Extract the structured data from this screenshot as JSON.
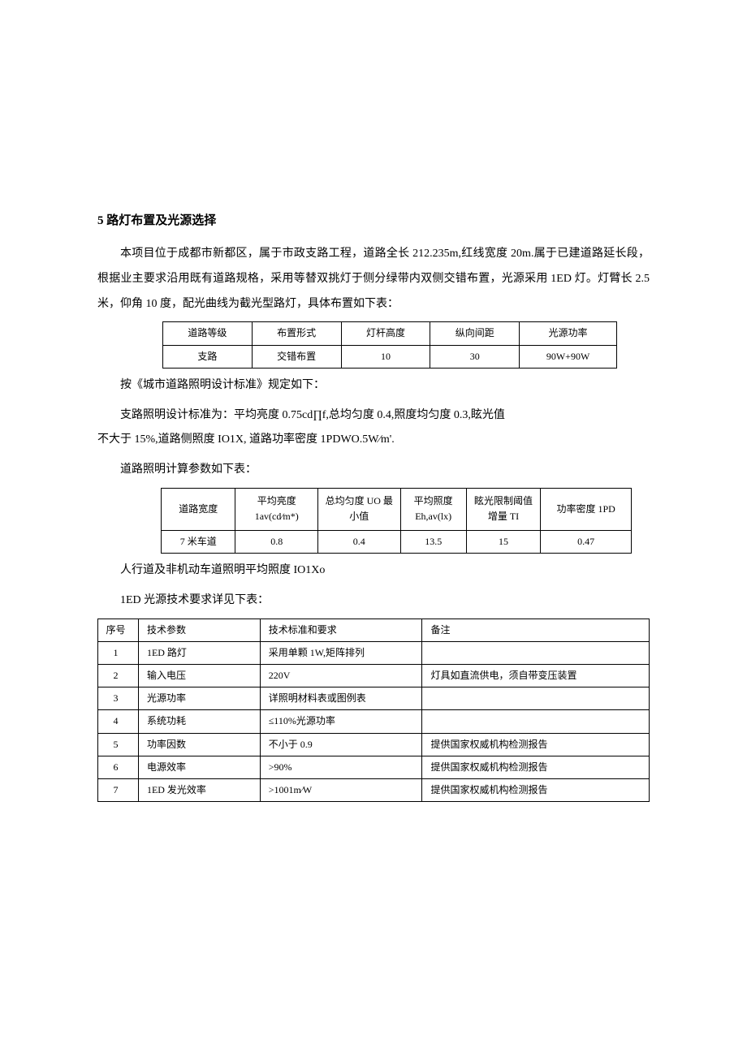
{
  "heading": "5 路灯布置及光源选择",
  "p1": "本项目位于成都市新都区，属于市政支路工程，道路全长 212.235m,红线宽度 20m.属于已建道路延长段，根据业主要求沿用既有道路规格，采用等替双挑灯于侧分绿带内双侧交错布置，光源采用 1ED 灯。灯臂长 2.5 米，仰角 10 度，配光曲线为截光型路灯，具体布置如下表：",
  "table1": {
    "h": [
      "道路等级",
      "布置形式",
      "灯杆高度",
      "纵向间距",
      "光源功率"
    ],
    "r": [
      "支路",
      "交错布置",
      "10",
      "30",
      "90W+90W"
    ]
  },
  "p2": "按《城市道路照明设计标准》规定如下：",
  "p3a": "支路照明设计标准为：平均亮度 0.75cd∏f,总均匀度 0.4,照度均匀度 0.3,眩光值",
  "p3b": "不大于 15%,道路侧照度 IO1X, 道路功率密度 1PDWO.5W⁄m'.",
  "p4": "道路照明计算参数如下表：",
  "table2": {
    "h": [
      "道路宽度",
      "平均亮度\n1av(cd⁄m*)",
      "总均匀度 UO 最小值",
      "平均照度\nEh,av(lx)",
      "眩光限制阈值增量\nTI",
      "功率密度 1PD"
    ],
    "r": [
      "7 米车道",
      "0.8",
      "0.4",
      "13.5",
      "15",
      "0.47"
    ]
  },
  "p5": "人行道及非机动车道照明平均照度 IO1Xo",
  "p6": "1ED 光源技术要求详见下表：",
  "table3": {
    "h": [
      "序号",
      "技术参数",
      "技术标准和要求",
      "备注"
    ],
    "rows": [
      [
        "1",
        "1ED 路灯",
        "采用单颗 1W,矩阵排列",
        ""
      ],
      [
        "2",
        "输入电压",
        "220V",
        "灯具如直流供电，须自带变压装置"
      ],
      [
        "3",
        "光源功率",
        "详照明材料表或图例表",
        ""
      ],
      [
        "4",
        "系统功耗",
        "≤110%光源功率",
        ""
      ],
      [
        "5",
        "功率因数",
        "不小于 0.9",
        "提供国家权威机构检测报告"
      ],
      [
        "6",
        "电源效率",
        ">90%",
        "提供国家权威机构检测报告"
      ],
      [
        "7",
        "1ED 发光效率",
        ">1001m⁄W",
        "提供国家权威机构检测报告"
      ]
    ]
  }
}
